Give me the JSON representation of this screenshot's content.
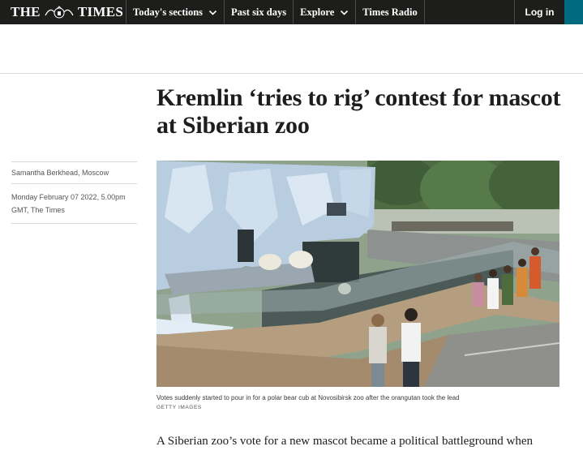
{
  "nav": {
    "logo_left": "THE",
    "logo_right": "TIMES",
    "items": [
      {
        "label": "Today's sections",
        "has_dropdown": true
      },
      {
        "label": "Past six days",
        "has_dropdown": false
      },
      {
        "label": "Explore",
        "has_dropdown": true
      },
      {
        "label": "Times Radio",
        "has_dropdown": false
      }
    ],
    "login_label": "Log in",
    "colors": {
      "bar": "#1d1d1b",
      "accent": "#006b80"
    }
  },
  "article": {
    "headline": "Kremlin ‘tries to rig’ contest for mascot at Siberian zoo",
    "author": "Samantha Berkhead, Moscow",
    "date": "Monday February 07 2022, 5.00pm GMT, The Times",
    "caption": "Votes suddenly started to pour in for a polar bear cub at Novosibirsk zoo after the orangutan took the lead",
    "credit": "GETTY IMAGES",
    "body_first_line": "A Siberian zoo’s vote for a new mascot became a political battleground when"
  }
}
